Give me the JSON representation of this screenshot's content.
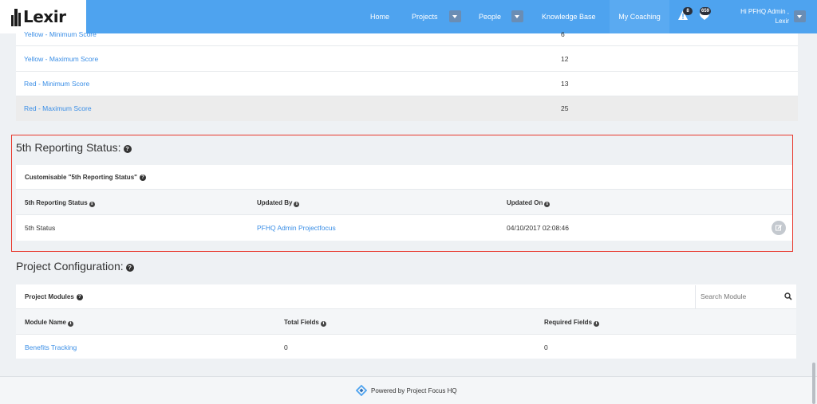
{
  "app": {
    "logo_text": "Lexir"
  },
  "nav": {
    "home": "Home",
    "projects": "Projects",
    "people": "People",
    "knowledge_base": "Knowledge Base",
    "my_coaching": "My Coaching",
    "alerts_count": "8",
    "notifications_count": "659",
    "greeting_line1": "Hi PFHQ Admin ,",
    "greeting_line2": "Lexir"
  },
  "score_table": {
    "rows": [
      {
        "label": "Yellow - Minimum Score",
        "value": "6"
      },
      {
        "label": "Yellow - Maximum Score",
        "value": "12"
      },
      {
        "label": "Red - Minimum Score",
        "value": "13"
      },
      {
        "label": "Red - Maximum Score",
        "value": "25"
      }
    ]
  },
  "reporting_status": {
    "section_title": "5th Reporting Status:",
    "panel_title": "Customisable \"5th Reporting Status\"",
    "columns": [
      "5th Reporting Status",
      "Updated By",
      "Updated On"
    ],
    "row": {
      "status": "5th Status",
      "updated_by": "PFHQ Admin Projectfocus",
      "updated_on": "04/10/2017 02:08:46"
    }
  },
  "project_config": {
    "section_title": "Project Configuration:",
    "panel_title": "Project Modules",
    "search_placeholder": "Search Module",
    "columns": [
      "Module Name",
      "Total Fields",
      "Required Fields"
    ],
    "rows": [
      {
        "module": "Benefits Tracking",
        "total": "0",
        "required": "0"
      }
    ]
  },
  "footer": {
    "text": "Powered by Project Focus HQ"
  },
  "colors": {
    "navbar": "#4ea3ef",
    "link": "#3a8ee6",
    "highlight": "#e8372c"
  }
}
